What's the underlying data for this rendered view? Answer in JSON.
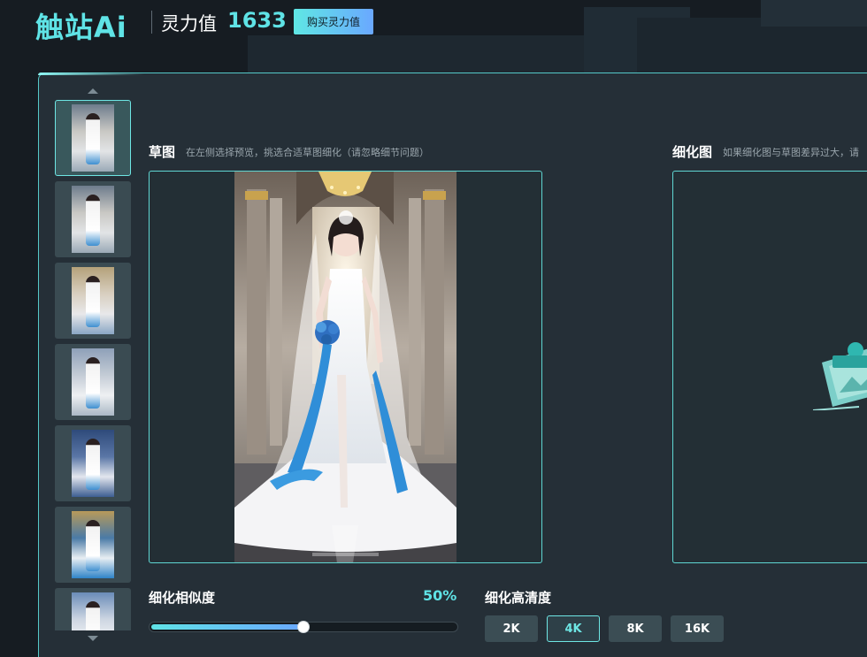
{
  "header": {
    "logo": "触站Ai",
    "power_label": "灵力值",
    "power_value": "1633",
    "buy_button": "购买灵力值"
  },
  "thumbnails": {
    "count": 7,
    "active_index": 0
  },
  "draft": {
    "title": "草图",
    "hint": "在左侧选择预览，挑选合适草图细化（请忽略细节问题）"
  },
  "refine": {
    "title": "细化图",
    "hint": "如果细化图与草图差异过大，请"
  },
  "similarity": {
    "label": "细化相似度",
    "value_text": "50%",
    "value": 50
  },
  "resolution": {
    "label": "细化高清度",
    "options": [
      "2K",
      "4K",
      "8K",
      "16K"
    ],
    "selected": "4K"
  },
  "colors": {
    "accent": "#5fe3e6",
    "panel": "#252f37",
    "background": "#161c22"
  }
}
